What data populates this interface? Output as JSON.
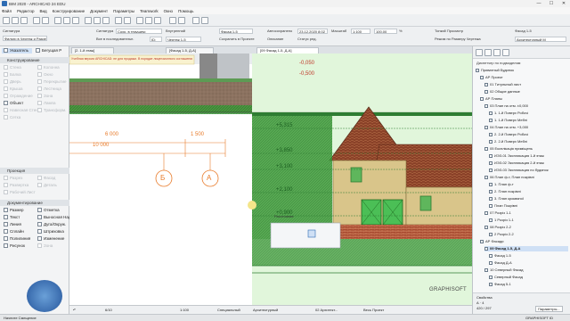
{
  "window": {
    "title": "BIM 2020 - ARCHICAD 24 EDU",
    "controls": [
      "—",
      "☐",
      "✕"
    ]
  },
  "menu": [
    "Файл",
    "Редактор",
    "Вид",
    "Конструирование",
    "Документ",
    "Параметры",
    "Teamwork",
    "Окно",
    "Помощь"
  ],
  "toolbar": {
    "view_label": "Фильтр в Чертеж и Разрезах",
    "fields": [
      {
        "label": "Сигнатура",
        "value": "Сохр. в текущем:"
      },
      {
        "label": "Все в последовательн.",
        "value": "ID:"
      },
      {
        "label": "Внутренний",
        "value": ""
      },
      {
        "label": "Чертеж 1-5",
        "value": "Фасад 1-5"
      },
      {
        "label": "Автосохранено",
        "value": "23.12.2020 8:02"
      },
      {
        "label": "Масштаб",
        "value": "1:100"
      },
      {
        "label": "Этап",
        "value": "100.00"
      },
      {
        "label": "Нагрузки",
        "value": "%"
      },
      {
        "label": "Тонкий Просмотр",
        "value": ""
      },
      {
        "label": "Режим по Размеру Чертежа",
        "value": ""
      },
      {
        "label": "Фасад 1-5",
        "value": "Архитектурный М"
      }
    ],
    "checkbox_label": "Сохранить в Проекте",
    "status_label": "Описание",
    "stage_label": "Статус ред."
  },
  "toolbox": {
    "select_tool": "Указатель",
    "marquee_tool": "Бегущая Р",
    "sections": [
      {
        "title": "Конструирование",
        "tools": [
          "Стена",
          "Колонна",
          "Балка",
          "Окно",
          "Дверь",
          "Перекрытие",
          "Крыша",
          "Лестница",
          "Ограждение",
          "Зона",
          "Объект",
          "Лампа",
          "Навесная Стена",
          "Трансформ.",
          "Сетка"
        ]
      },
      {
        "title": "Проекция",
        "tools": [
          "Разрез",
          "Фасад",
          "Развертка",
          "Деталь",
          "Рабочий Лист"
        ]
      },
      {
        "title": "Документирование",
        "tools": [
          "Размер",
          "Отметка",
          "Текст",
          "Выносная Надпись",
          "Линия",
          "Дуга/Окруж.",
          "Сплайн",
          "Штриховка",
          "Полилиния",
          "Изменение",
          "Рисунок",
          "Зона"
        ]
      }
    ],
    "enabled_tools": [
      "Объект",
      "Размер",
      "Отметка",
      "Текст",
      "Выносная Надпись",
      "Штриховка",
      "Линия",
      "Изменение",
      "Дуга/Окруж.",
      "Полилиния",
      "Сплайн",
      "Рисунок"
    ]
  },
  "tabs": [
    {
      "label": "[2. 1-й этаж]"
    },
    {
      "label": "[Фасад 1-5, Д-А]"
    },
    {
      "label": "[09 Фасад 1-5, Д-А]"
    }
  ],
  "canvas": {
    "warning_text": "Учебная версия ARCHICAD: не для продажи. В порядке лицензионного соглашения.",
    "elevations": [
      "-0,050",
      "-0,500",
      "+5,315",
      "+3,850",
      "+3,100",
      "+2,100",
      "+0,900"
    ],
    "dims": [
      "6 000",
      "1 500",
      "10 000"
    ],
    "axes": [
      "Б",
      "А"
    ],
    "pet_palette_label": "Расстояние",
    "watermark": "GRAPHISOFT"
  },
  "status": {
    "undo": "↶",
    "page": "6/10",
    "scale": "1:100",
    "layer_combo": "Специальный",
    "model": "Архитектурный",
    "renovation": "02 Архитект...",
    "set": "Весь Проект"
  },
  "navigator": {
    "title": "Диспетчер по подмоделям",
    "items": [
      {
        "depth": 0,
        "label": "Приватный Будинок"
      },
      {
        "depth": 1,
        "label": "АР Проект"
      },
      {
        "depth": 2,
        "label": "01 Титульный лист"
      },
      {
        "depth": 2,
        "label": "02 Общие данные"
      },
      {
        "depth": 1,
        "label": "АР Планы"
      },
      {
        "depth": 2,
        "label": "03 План на отм. ±0,000"
      },
      {
        "depth": 3,
        "label": "1. 1-й Поверх Робочі"
      },
      {
        "depth": 3,
        "label": "1. 1-й Поверх Меблі"
      },
      {
        "depth": 2,
        "label": "04 План на отм. +3,000"
      },
      {
        "depth": 3,
        "label": "2. 2-й Поверх Робочі"
      },
      {
        "depth": 3,
        "label": "2. 2-й Поверх Меблі"
      },
      {
        "depth": 2,
        "label": "05 Експлікація приміщень"
      },
      {
        "depth": 3,
        "label": "ИЭЗ-01 Экспликация 1-й этаж"
      },
      {
        "depth": 3,
        "label": "ИЭЗ-02 Экспликация 2-й этаж"
      },
      {
        "depth": 3,
        "label": "ИЭЗ-03 Экспликация по будинок"
      },
      {
        "depth": 2,
        "label": "06 План ф-т, План покрівлі"
      },
      {
        "depth": 3,
        "label": "1. План ф-т"
      },
      {
        "depth": 3,
        "label": "2. План покрівлі"
      },
      {
        "depth": 3,
        "label": "3. План кроквяної"
      },
      {
        "depth": 3,
        "label": "План Покрівлі"
      },
      {
        "depth": 2,
        "label": "07 Розріз 1-1"
      },
      {
        "depth": 3,
        "label": "1 Розріз 1-1"
      },
      {
        "depth": 2,
        "label": "08 Розріз 2-2"
      },
      {
        "depth": 3,
        "label": "2 Розріз 2-2"
      },
      {
        "depth": 1,
        "label": "АР Фасади"
      },
      {
        "depth": 2,
        "label": "09 Фасад 1-5, Д-А",
        "selected": true
      },
      {
        "depth": 3,
        "label": "Фасад 1-5"
      },
      {
        "depth": 3,
        "label": "Фасад Д-А"
      },
      {
        "depth": 2,
        "label": "10 Северный Фасад"
      },
      {
        "depth": 3,
        "label": "Северный Фасад"
      },
      {
        "depth": 3,
        "label": "Фасад 5-1"
      }
    ],
    "props_title": "Свойства",
    "props_id": "А · 4",
    "props_name": "#0 · 7",
    "props_size": "420 / 297",
    "params_label": "Параметры..."
  },
  "taskbar": {
    "left": "Начните Смещение",
    "right": "GRAPHISOFT ID"
  },
  "colors": {
    "green_select": "#3fae3f",
    "wall_beige": "#d9c58a",
    "roof_brown": "#7b3a23",
    "brick_red": "#a84a31",
    "axis_orange": "#e87b2a"
  }
}
